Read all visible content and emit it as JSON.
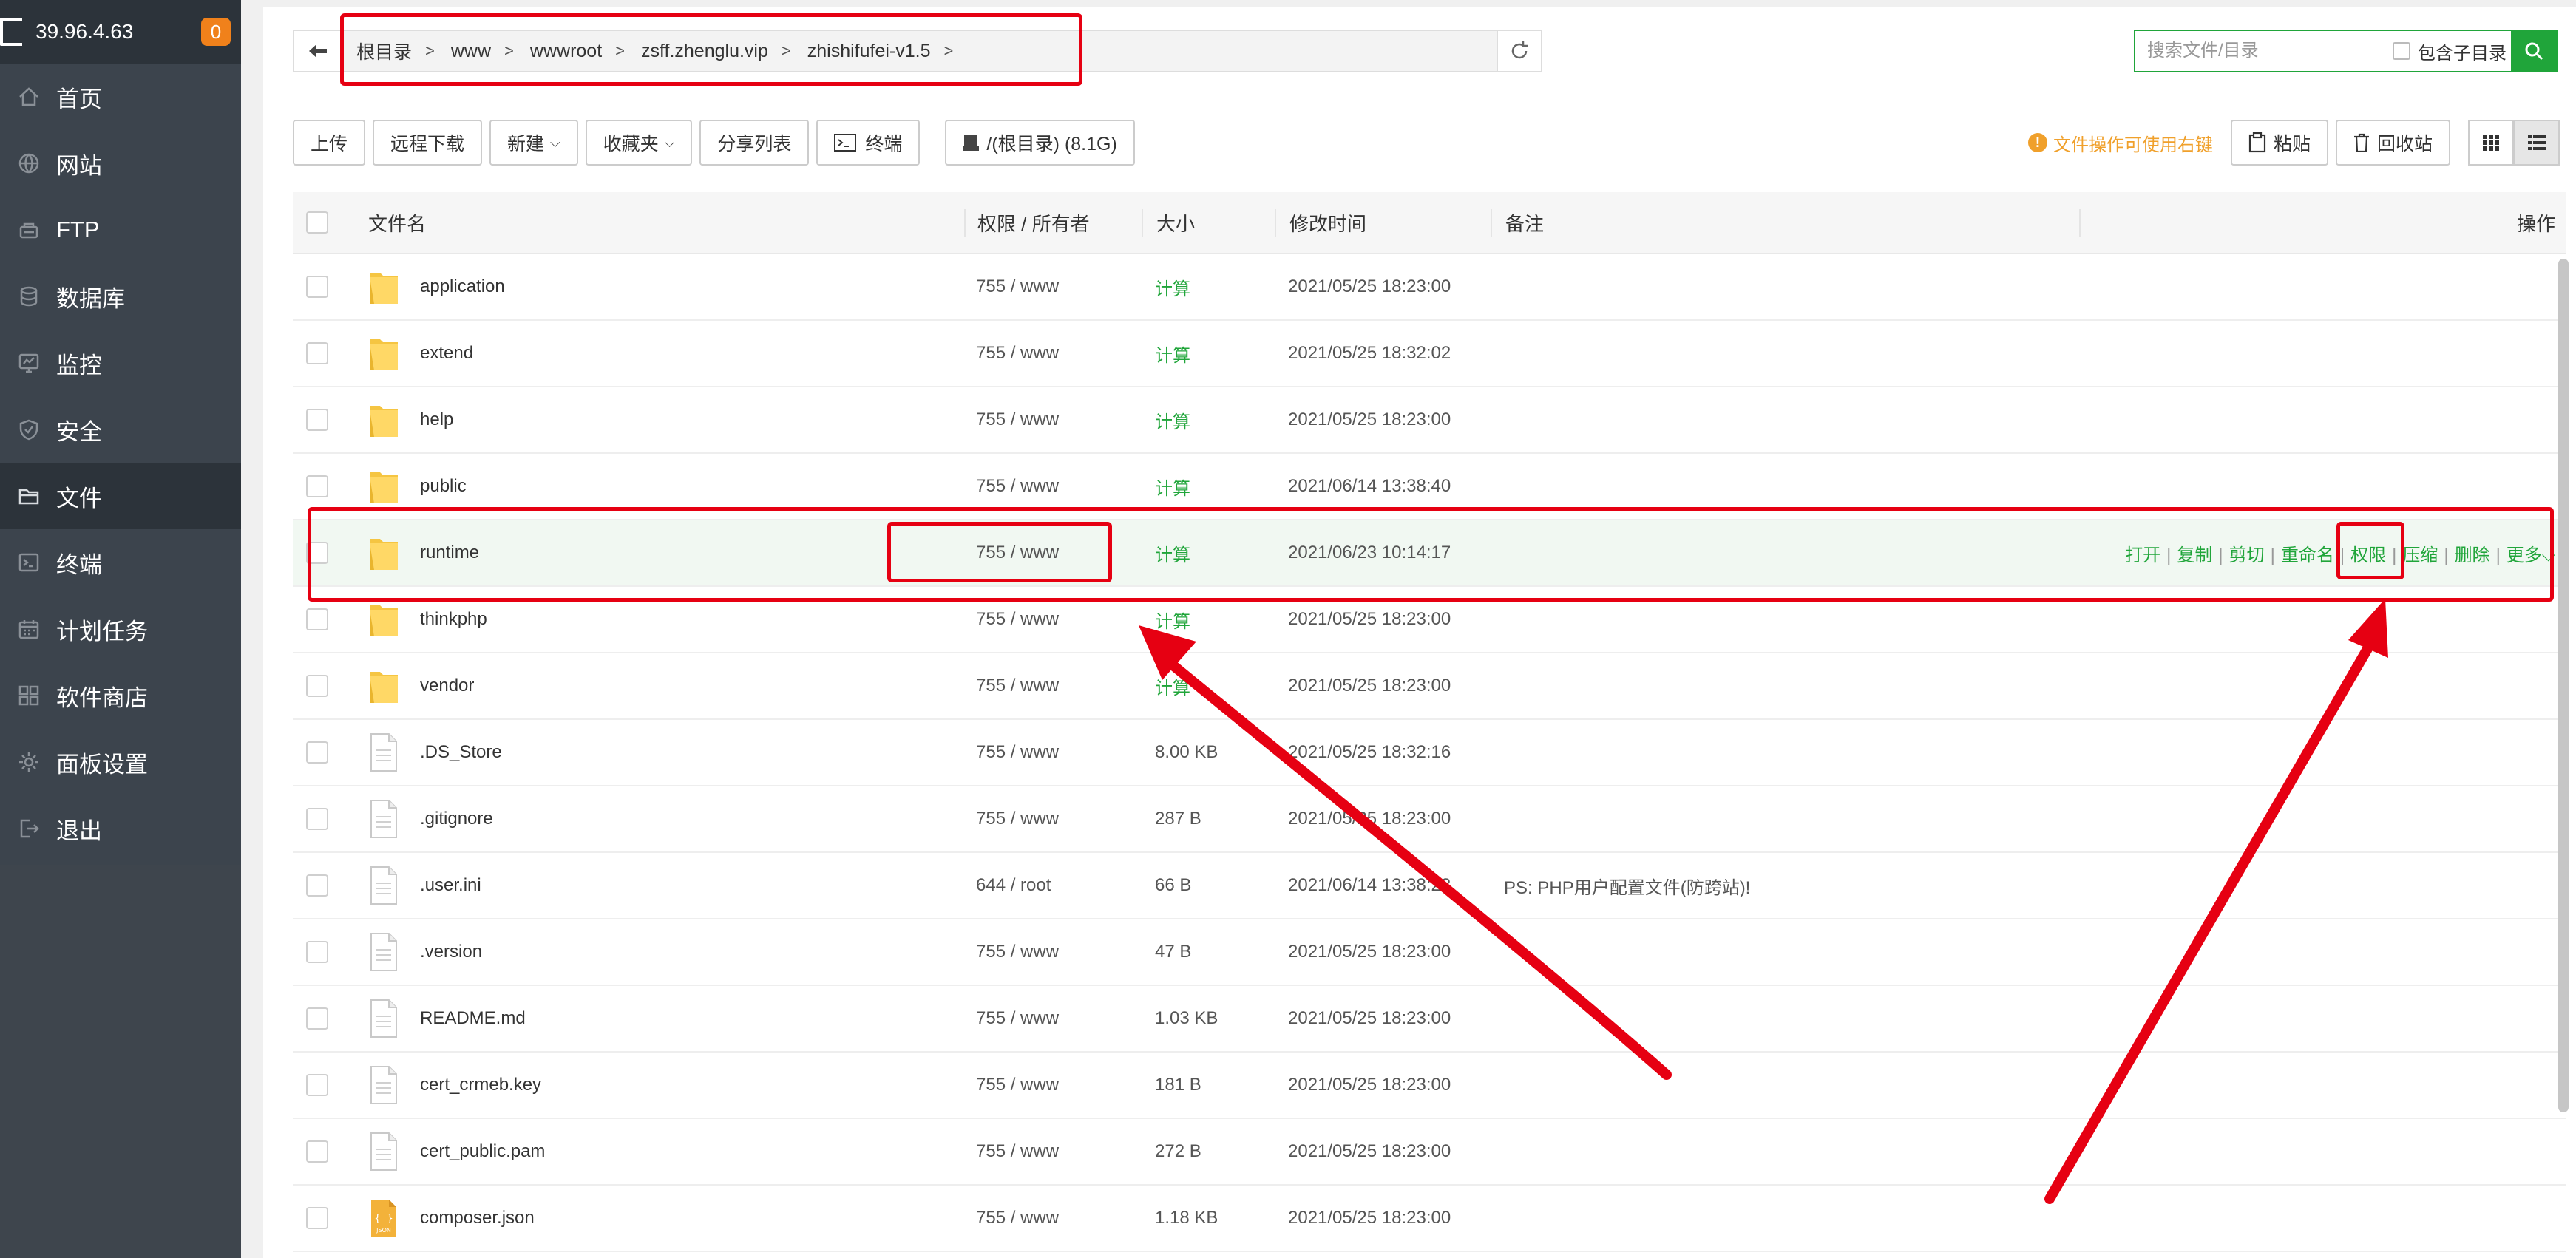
{
  "server": {
    "ip": "39.96.4.63",
    "badge": "0"
  },
  "sidebar": {
    "items": [
      {
        "label": "首页",
        "icon": "home-icon"
      },
      {
        "label": "网站",
        "icon": "globe-icon"
      },
      {
        "label": "FTP",
        "icon": "ftp-icon"
      },
      {
        "label": "数据库",
        "icon": "database-icon"
      },
      {
        "label": "监控",
        "icon": "monitor-icon"
      },
      {
        "label": "安全",
        "icon": "shield-icon"
      },
      {
        "label": "文件",
        "icon": "folder-icon",
        "active": true
      },
      {
        "label": "终端",
        "icon": "terminal-icon"
      },
      {
        "label": "计划任务",
        "icon": "calendar-icon"
      },
      {
        "label": "软件商店",
        "icon": "apps-icon"
      },
      {
        "label": "面板设置",
        "icon": "gear-icon"
      },
      {
        "label": "退出",
        "icon": "logout-icon"
      }
    ]
  },
  "breadcrumb": {
    "items": [
      "根目录",
      "www",
      "wwwroot",
      "zsff.zhenglu.vip",
      "zhishifufei-v1.5"
    ]
  },
  "search": {
    "placeholder": "搜索文件/目录",
    "include_subdir": "包含子目录"
  },
  "toolbar": {
    "upload": "上传",
    "remote_download": "远程下载",
    "new": "新建",
    "favorites": "收藏夹",
    "share_list": "分享列表",
    "terminal": "终端",
    "disk": "/(根目录) (8.1G)",
    "hint": "文件操作可使用右键",
    "paste": "粘贴",
    "recycle": "回收站"
  },
  "table": {
    "headers": {
      "name": "文件名",
      "perm": "权限 / 所有者",
      "size": "大小",
      "mtime": "修改时间",
      "note": "备注",
      "ops": "操作"
    },
    "rows": [
      {
        "name": "application",
        "type": "folder",
        "perm": "755 / www",
        "size": "计算",
        "mtime": "2021/05/25 18:23:00",
        "note": ""
      },
      {
        "name": "extend",
        "type": "folder",
        "perm": "755 / www",
        "size": "计算",
        "mtime": "2021/05/25 18:32:02",
        "note": ""
      },
      {
        "name": "help",
        "type": "folder",
        "perm": "755 / www",
        "size": "计算",
        "mtime": "2021/05/25 18:23:00",
        "note": ""
      },
      {
        "name": "public",
        "type": "folder",
        "perm": "755 / www",
        "size": "计算",
        "mtime": "2021/06/14 13:38:40",
        "note": ""
      },
      {
        "name": "runtime",
        "type": "folder",
        "perm": "755 / www",
        "size": "计算",
        "mtime": "2021/06/23 10:14:17",
        "note": "",
        "highlight": true
      },
      {
        "name": "thinkphp",
        "type": "folder",
        "perm": "755 / www",
        "size": "计算",
        "mtime": "2021/05/25 18:23:00",
        "note": ""
      },
      {
        "name": "vendor",
        "type": "folder",
        "perm": "755 / www",
        "size": "计算",
        "mtime": "2021/05/25 18:23:00",
        "note": ""
      },
      {
        "name": ".DS_Store",
        "type": "file",
        "perm": "755 / www",
        "size": "8.00 KB",
        "mtime": "2021/05/25 18:32:16",
        "note": ""
      },
      {
        "name": ".gitignore",
        "type": "file",
        "perm": "755 / www",
        "size": "287 B",
        "mtime": "2021/05/25 18:23:00",
        "note": ""
      },
      {
        "name": ".user.ini",
        "type": "file",
        "perm": "644 / root",
        "size": "66 B",
        "mtime": "2021/06/14 13:38:28",
        "note": "PS: PHP用户配置文件(防跨站)!"
      },
      {
        "name": ".version",
        "type": "file",
        "perm": "755 / www",
        "size": "47 B",
        "mtime": "2021/05/25 18:23:00",
        "note": ""
      },
      {
        "name": "README.md",
        "type": "file",
        "perm": "755 / www",
        "size": "1.03 KB",
        "mtime": "2021/05/25 18:23:00",
        "note": ""
      },
      {
        "name": "cert_crmeb.key",
        "type": "file",
        "perm": "755 / www",
        "size": "181 B",
        "mtime": "2021/05/25 18:23:00",
        "note": ""
      },
      {
        "name": "cert_public.pam",
        "type": "file",
        "perm": "755 / www",
        "size": "272 B",
        "mtime": "2021/05/25 18:23:00",
        "note": ""
      },
      {
        "name": "composer.json",
        "type": "json",
        "perm": "755 / www",
        "size": "1.18 KB",
        "mtime": "2021/05/25 18:23:00",
        "note": ""
      }
    ],
    "row_actions": [
      "打开",
      "复制",
      "剪切",
      "重命名",
      "权限",
      "压缩",
      "删除",
      "更多"
    ]
  },
  "colors": {
    "accent": "#20a53a",
    "sidebar": "#3c444d",
    "annotation": "#e60012",
    "hint": "#f0a02b"
  }
}
